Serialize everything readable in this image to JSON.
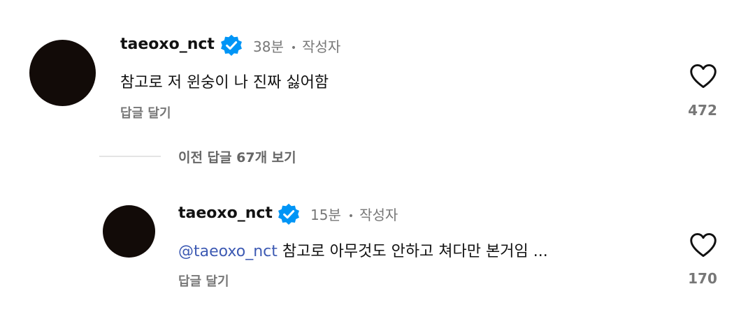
{
  "comments": [
    {
      "username": "taeoxo_nct",
      "verified": true,
      "time": "38분",
      "separator": "•",
      "author_tag": "작성자",
      "mention": "",
      "text": "참고로 저 윈숭이 나 진짜 싫어함",
      "reply_label": "답글 달기",
      "like_count": "472"
    },
    {
      "username": "taeoxo_nct",
      "verified": true,
      "time": "15분",
      "separator": "•",
      "author_tag": "작성자",
      "mention": "@taeoxo_nct",
      "text": "참고로 아무것도 안하고 쳐다만 본거임 ...",
      "reply_label": "답글 달기",
      "like_count": "170"
    }
  ],
  "thread": {
    "view_previous_label": "이전 답글 67개 보기"
  },
  "colors": {
    "verified_badge": "#0095f6",
    "meta_text": "#777777",
    "mention": "#3d5ab3",
    "avatar": "#120b08"
  },
  "icons": {
    "verified": "verified-badge-icon",
    "like": "heart-outline-icon"
  }
}
